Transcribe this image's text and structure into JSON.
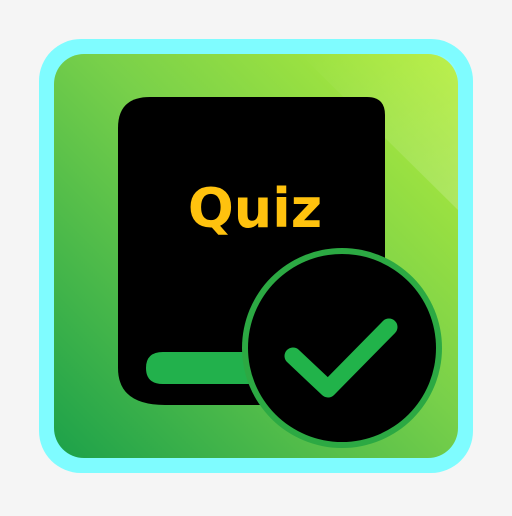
{
  "icon": {
    "label": "Quiz",
    "glyphs": [
      "book-icon",
      "check-icon"
    ],
    "colors": {
      "background": "#f5f5f5",
      "frame_glow": "#7ffcff",
      "gradient_top": "#b5ee3a",
      "gradient_bottom": "#1ca14a",
      "book": "#000000",
      "book_page": "#22b14c",
      "badge_ring": "#2ca943",
      "check": "#21b34a",
      "label_text": "#ffc20e"
    }
  }
}
